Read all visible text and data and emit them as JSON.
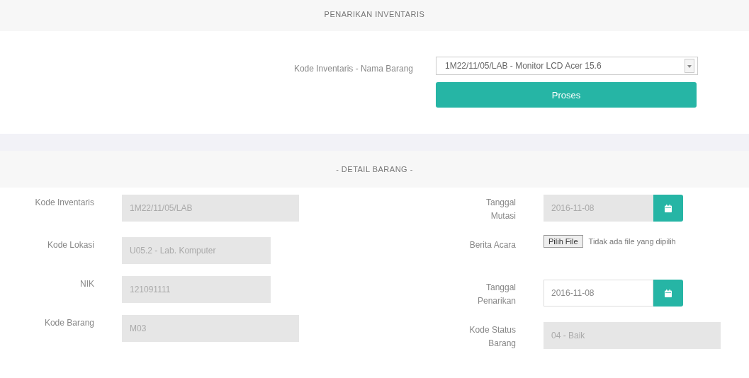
{
  "title": "PENARIKAN INVENTARIS",
  "selector": {
    "label": "Kode Inventaris - Nama Barang",
    "value": "1M22/11/05/LAB - Monitor LCD Acer 15.6"
  },
  "process_button": "Proses",
  "detail_title": "- DETAIL BARANG -",
  "left_fields": [
    {
      "kind": "text",
      "label": "Kode Inventaris",
      "value": "1M22/11/05/LAB",
      "disabled": true
    },
    {
      "kind": "text",
      "label": "Kode Lokasi",
      "value": "U05.2 - Lab. Komputer",
      "disabled": true
    },
    {
      "kind": "text",
      "label": "NIK",
      "value": "121091111",
      "disabled": true
    },
    {
      "kind": "text",
      "label": "Kode Barang",
      "value": "M03",
      "disabled": true
    }
  ],
  "right_fields": [
    {
      "kind": "date",
      "label": "Tanggal Mutasi",
      "value": "2016-11-08",
      "disabled": true
    },
    {
      "kind": "file",
      "label": "Berita Acara",
      "button": "Pilih File",
      "status": "Tidak ada file yang dipilih"
    },
    {
      "kind": "date",
      "label": "Tanggal Penarikan",
      "value": "2016-11-08",
      "disabled": false
    },
    {
      "kind": "text",
      "label": "Kode Status Barang",
      "value": "04 - Baik",
      "disabled": true
    }
  ]
}
